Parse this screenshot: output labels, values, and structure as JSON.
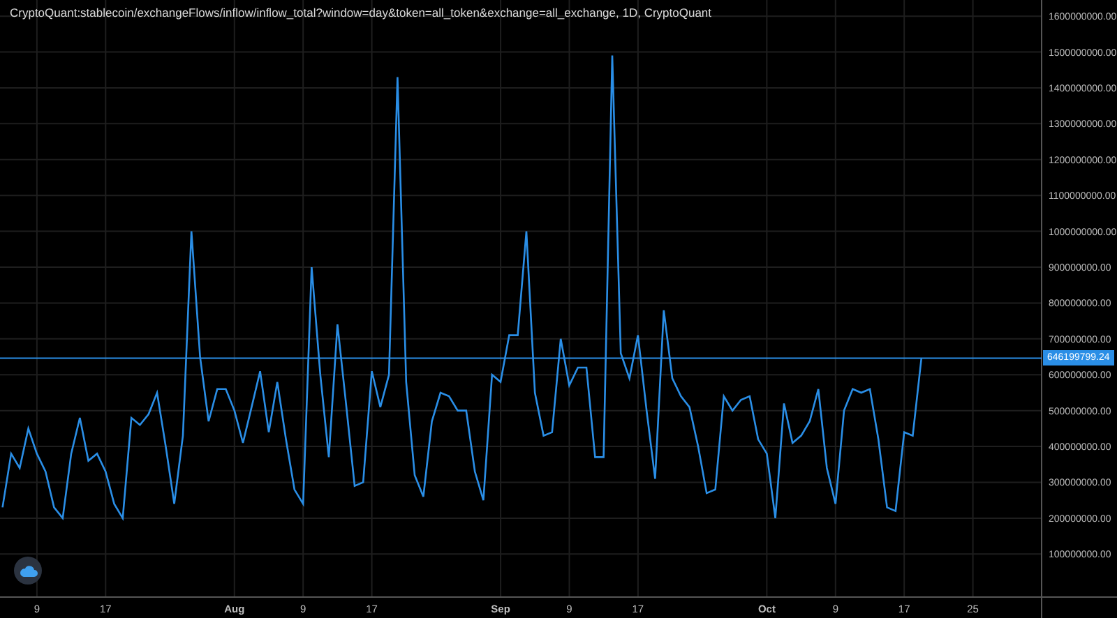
{
  "title": "CryptoQuant:stablecoin/exchangeFlows/inflow/inflow_total?window=day&token=all_token&exchange=all_exchange, 1D, CryptoQuant",
  "chart_data": {
    "type": "line",
    "categories": [
      null,
      null,
      null,
      null,
      "9",
      null,
      null,
      null,
      null,
      null,
      null,
      null,
      "17",
      null,
      null,
      null,
      null,
      null,
      null,
      null,
      null,
      null,
      null,
      null,
      null,
      null,
      null,
      "Aug",
      null,
      null,
      null,
      null,
      null,
      null,
      null,
      "9",
      null,
      null,
      null,
      null,
      null,
      null,
      null,
      "17",
      null,
      null,
      null,
      null,
      null,
      null,
      null,
      null,
      null,
      null,
      null,
      null,
      null,
      null,
      "Sep",
      null,
      null,
      null,
      null,
      null,
      null,
      null,
      "9",
      null,
      null,
      null,
      null,
      null,
      null,
      null,
      "17",
      null,
      null,
      null,
      null,
      null,
      null,
      null,
      null,
      null,
      null,
      null,
      null,
      null,
      null,
      "Oct",
      null,
      null,
      null,
      null,
      null,
      null,
      null,
      "9",
      null,
      null,
      null,
      null,
      null,
      null,
      null,
      "17",
      null,
      null,
      null,
      null,
      null,
      null,
      null,
      "25",
      null,
      null
    ],
    "series": [
      {
        "color": "#2a8ee6",
        "values": [
          230000000,
          380000000,
          340000000,
          450000000,
          380000000,
          330000000,
          230000000,
          200000000,
          380000000,
          480000000,
          360000000,
          380000000,
          330000000,
          240000000,
          200000000,
          480000000,
          460000000,
          490000000,
          550000000,
          400000000,
          240000000,
          430000000,
          1000000000,
          650000000,
          470000000,
          560000000,
          560000000,
          500000000,
          410000000,
          510000000,
          610000000,
          440000000,
          580000000,
          420000000,
          280000000,
          240000000,
          900000000,
          600000000,
          370000000,
          740000000,
          520000000,
          290000000,
          300000000,
          610000000,
          510000000,
          600000000,
          1430000000,
          580000000,
          320000000,
          260000000,
          470000000,
          550000000,
          540000000,
          500000000,
          500000000,
          330000000,
          250000000,
          600000000,
          580000000,
          710000000,
          710000000,
          1000000000,
          550000000,
          430000000,
          440000000,
          700000000,
          570000000,
          620000000,
          620000000,
          370000000,
          370000000,
          1490000000,
          660000000,
          590000000,
          710000000,
          500000000,
          310000000,
          780000000,
          590000000,
          540000000,
          510000000,
          400000000,
          270000000,
          280000000,
          540000000,
          500000000,
          530000000,
          540000000,
          420000000,
          380000000,
          200000000,
          520000000,
          410000000,
          430000000,
          470000000,
          560000000,
          340000000,
          240000000,
          500000000,
          560000000,
          550000000,
          560000000,
          420000000,
          230000000,
          220000000,
          440000000,
          430000000,
          646000000,
          null,
          null,
          null,
          null,
          null,
          null,
          null,
          null
        ]
      }
    ],
    "ylim": [
      -20000000,
      1645000000
    ],
    "yticks": [
      {
        "value": 100000000,
        "label": "100000000.00"
      },
      {
        "value": 200000000,
        "label": "200000000.00"
      },
      {
        "value": 300000000,
        "label": "300000000.00"
      },
      {
        "value": 400000000,
        "label": "400000000.00"
      },
      {
        "value": 500000000,
        "label": "500000000.00"
      },
      {
        "value": 600000000,
        "label": "600000000.00"
      },
      {
        "value": 700000000,
        "label": "700000000.00"
      },
      {
        "value": 800000000,
        "label": "800000000.00"
      },
      {
        "value": 900000000,
        "label": "900000000.00"
      },
      {
        "value": 1000000000,
        "label": "1000000000.00"
      },
      {
        "value": 1100000000,
        "label": "1100000000.00"
      },
      {
        "value": 1200000000,
        "label": "1200000000.00"
      },
      {
        "value": 1300000000,
        "label": "1300000000.00"
      },
      {
        "value": 1400000000,
        "label": "1400000000.00"
      },
      {
        "value": 1500000000,
        "label": "1500000000.00"
      },
      {
        "value": 1600000000,
        "label": "1600000000.00"
      }
    ],
    "grid": true,
    "ref_lines": [
      {
        "axis": "y",
        "value": 646199799.24,
        "label": "646199799.24",
        "color": "#2a8ee6"
      }
    ]
  }
}
